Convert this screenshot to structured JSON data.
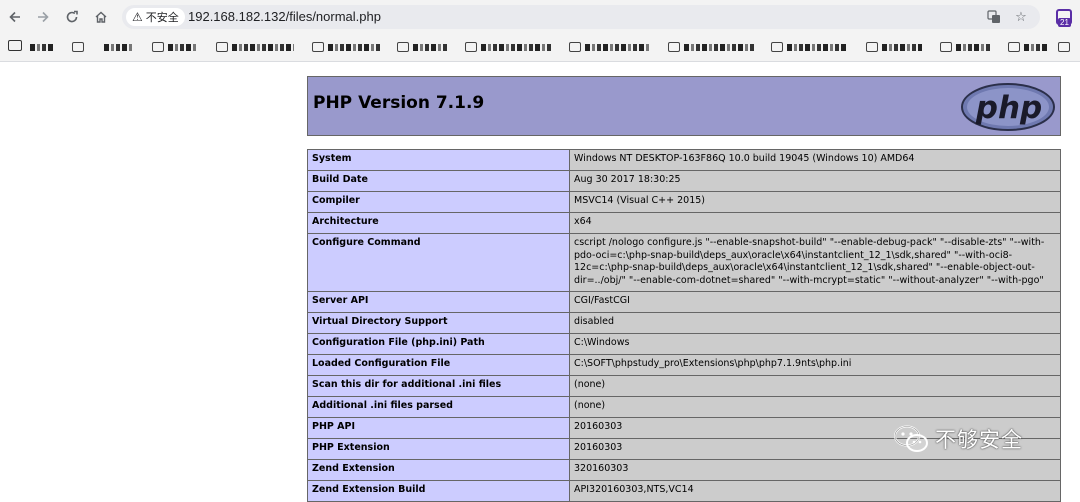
{
  "browser": {
    "security_label": "不安全",
    "url": "192.168.182.132/files/normal.php",
    "extension_badge": "21",
    "icons": [
      "back-icon",
      "forward-icon",
      "reload-icon",
      "home-icon",
      "warning-icon",
      "translate-icon",
      "star-icon",
      "extension-icon",
      "folder-icon"
    ]
  },
  "phpinfo": {
    "title": "PHP Version 7.1.9",
    "logo_text": "php",
    "rows": [
      {
        "key": "System",
        "value": "Windows NT DESKTOP-163F86Q 10.0 build 19045 (Windows 10) AMD64"
      },
      {
        "key": "Build Date",
        "value": "Aug 30 2017 18:30:25"
      },
      {
        "key": "Compiler",
        "value": "MSVC14 (Visual C++ 2015)"
      },
      {
        "key": "Architecture",
        "value": "x64"
      },
      {
        "key": "Configure Command",
        "value": "cscript /nologo configure.js \"--enable-snapshot-build\" \"--enable-debug-pack\" \"--disable-zts\" \"--with-pdo-oci=c:\\php-snap-build\\deps_aux\\oracle\\x64\\instantclient_12_1\\sdk,shared\" \"--with-oci8-12c=c:\\php-snap-build\\deps_aux\\oracle\\x64\\instantclient_12_1\\sdk,shared\" \"--enable-object-out-dir=../obj/\" \"--enable-com-dotnet=shared\" \"--with-mcrypt=static\" \"--without-analyzer\" \"--with-pgo\""
      },
      {
        "key": "Server API",
        "value": "CGI/FastCGI"
      },
      {
        "key": "Virtual Directory Support",
        "value": "disabled"
      },
      {
        "key": "Configuration File (php.ini) Path",
        "value": "C:\\Windows"
      },
      {
        "key": "Loaded Configuration File",
        "value": "C:\\SOFT\\phpstudy_pro\\Extensions\\php\\php7.1.9nts\\php.ini"
      },
      {
        "key": "Scan this dir for additional .ini files",
        "value": "(none)"
      },
      {
        "key": "Additional .ini files parsed",
        "value": "(none)"
      },
      {
        "key": "PHP API",
        "value": "20160303"
      },
      {
        "key": "PHP Extension",
        "value": "20160303"
      },
      {
        "key": "Zend Extension",
        "value": "320160303"
      },
      {
        "key": "Zend Extension Build",
        "value": "API320160303,NTS,VC14"
      }
    ]
  },
  "watermark": {
    "text": "不够安全"
  }
}
